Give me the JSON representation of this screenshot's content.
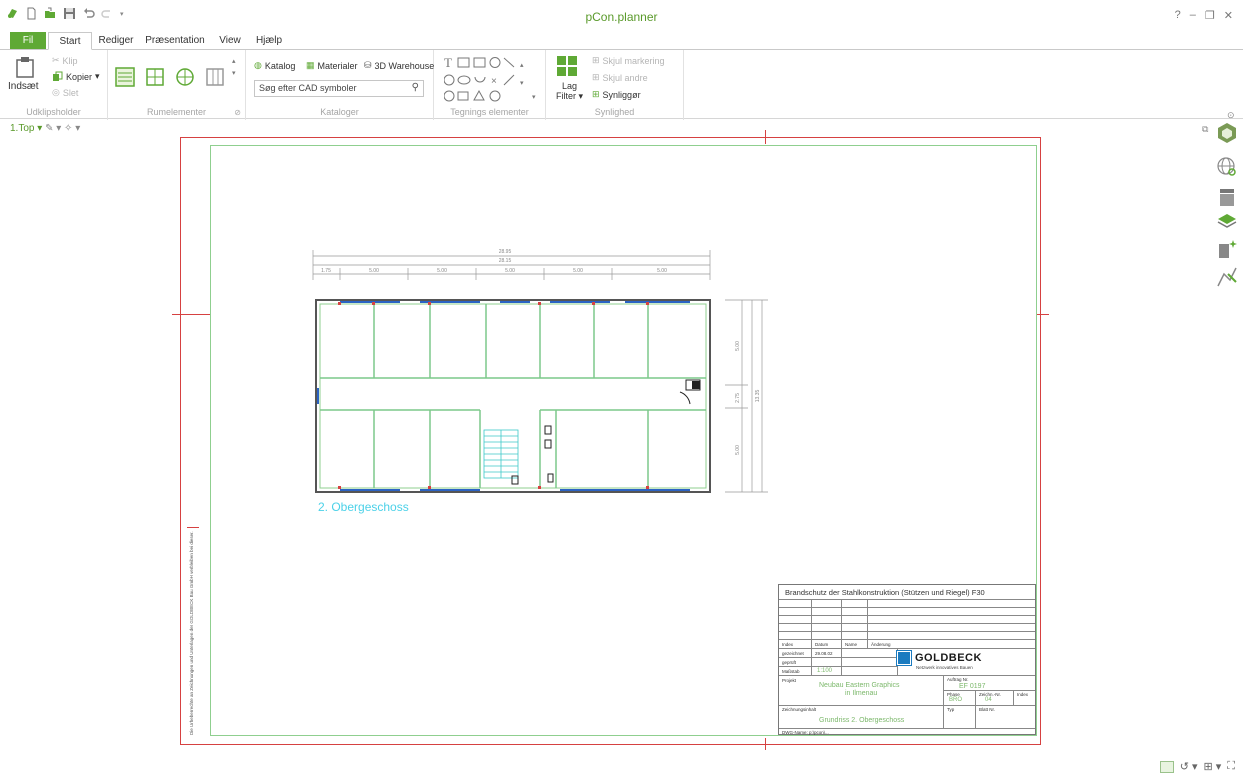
{
  "app": {
    "title": "pCon.planner"
  },
  "window_controls": {
    "help": "?",
    "minimize": "–",
    "restore": "❐",
    "close": "✕"
  },
  "tabs": [
    {
      "label": "Fil"
    },
    {
      "label": "Start"
    },
    {
      "label": "Rediger"
    },
    {
      "label": "Præsentation"
    },
    {
      "label": "View"
    },
    {
      "label": "Hjælp"
    }
  ],
  "ribbon": {
    "clipboard": {
      "paste": "Indsæt",
      "cut": "Klip",
      "copy": "Kopier",
      "delete": "Slet",
      "group": "Udklipsholder"
    },
    "room_elements": {
      "group": "Rumelementer"
    },
    "catalogs": {
      "catalog": "Katalog",
      "materials": "Materialer",
      "warehouse": "3D Warehouse",
      "search_placeholder": "Søg efter CAD symboler",
      "group": "Kataloger"
    },
    "drawing_elements": {
      "group": "Tegnings elementer"
    },
    "visibility": {
      "layer_filter_1": "Lag",
      "layer_filter_2": "Filter",
      "hide_selection": "Skjul markering",
      "hide_others": "Skjul andre",
      "show": "Synliggør",
      "group": "Synlighed"
    }
  },
  "canvas": {
    "view_selector": "1.Top",
    "plan_label": "2. Obergeschoss"
  },
  "title_block": {
    "title": "Brandschutz der Stahlkonstruktion (Stützen und Riegel) F30",
    "index_hdr": "Index",
    "datum_hdr": "Datum",
    "name_hdr": "Name",
    "aenderung_hdr": "Änderung",
    "gezeichnet": "gezeichnet",
    "date": "29.08.02",
    "geprueft": "geprüft",
    "massstab": "Maßstab",
    "scale": "1:100",
    "projekt": "Projekt",
    "project_name_1": "Neubau Eastern Graphics",
    "project_name_2": "in Ilmenau",
    "zeichnungsinhalt": "Zeichnungsinhalt",
    "drawing_content": "Grundriss 2. Obergeschoss",
    "auftrag": "Auftrag Nr.",
    "order_no": "EF 0197",
    "phase_hdr": "Phase",
    "zeichn_hdr": "Zeichn.-Nr.",
    "index2_hdr": "Index",
    "phase": "BRO",
    "drawing_no": "04",
    "typ": "Typ",
    "blatt": "Blatt Nr.",
    "logo": "GOLDBECK",
    "logo_sub": "Netzwerk innovatives Bauen",
    "dwg_name": "DWG-Name:  p:\\pcon\\...",
    "vertical_note": "Die Urheberrechte an Zeichnungen und Unterlagen der GOLDBECK Bau GmbH verbleiben bei dieser."
  },
  "dimensions": {
    "overall_1": "28.95",
    "overall_2": "28.15",
    "segments": [
      "1.75",
      "5.00",
      "5.00",
      "5.00",
      "5.00",
      "5.00"
    ],
    "side": [
      "5.00",
      "2.75",
      "5.00",
      "13.35"
    ]
  }
}
